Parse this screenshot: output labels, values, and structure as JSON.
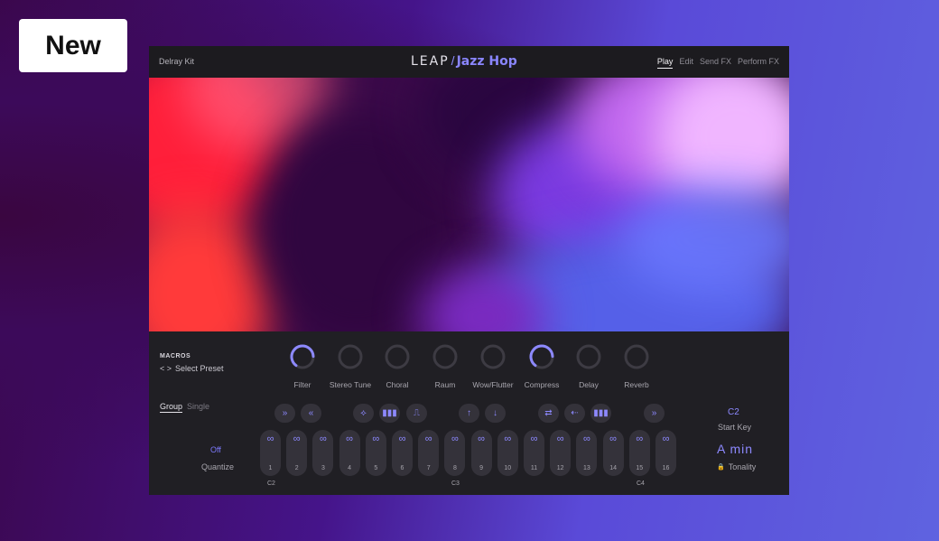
{
  "badge": "New",
  "header": {
    "kit_name": "Delray Kit",
    "brand_leap": "LEAP",
    "brand_slash": "/",
    "brand_name": "Jazz Hop",
    "tabs": [
      "Play",
      "Edit",
      "Send FX",
      "Perform FX"
    ],
    "active_tab": "Play"
  },
  "macros": {
    "title": "MACROS",
    "preset_arrows": "< >",
    "preset_label": "Select Preset",
    "knobs": [
      {
        "label": "Filter",
        "active": true,
        "level": 0.8
      },
      {
        "label": "Stereo Tune",
        "active": false,
        "level": 0
      },
      {
        "label": "Choral",
        "active": false,
        "level": 0
      },
      {
        "label": "Raum",
        "active": false,
        "level": 0
      },
      {
        "label": "Wow/Flutter",
        "active": false,
        "level": 0
      },
      {
        "label": "Compress",
        "active": true,
        "level": 0.8
      },
      {
        "label": "Delay",
        "active": false,
        "level": 0
      },
      {
        "label": "Reverb",
        "active": false,
        "level": 0
      }
    ]
  },
  "group_tabs": [
    "Group",
    "Single"
  ],
  "active_group_tab": "Group",
  "quantize": {
    "value": "Off",
    "label": "Quantize"
  },
  "actions": [
    {
      "icon": "fast-forward-icon",
      "glyph": "»"
    },
    {
      "icon": "rewind-icon",
      "glyph": "«"
    },
    {
      "icon": "shuffle-icon",
      "glyph": "⟡"
    },
    {
      "icon": "bars-icon",
      "glyph": "▮▮▮"
    },
    {
      "icon": "envelope-icon",
      "glyph": "⎍"
    },
    {
      "icon": "up-arrow-icon",
      "glyph": "↑"
    },
    {
      "icon": "down-arrow-icon",
      "glyph": "↓"
    },
    {
      "icon": "swap-icon",
      "glyph": "⇄"
    },
    {
      "icon": "scatter-icon",
      "glyph": "⇠"
    },
    {
      "icon": "bars-icon",
      "glyph": "▮▮▮"
    },
    {
      "icon": "fast-forward-icon",
      "glyph": "»"
    }
  ],
  "pads": {
    "glyph": "∞",
    "numbers": [
      "1",
      "2",
      "3",
      "4",
      "5",
      "6",
      "7",
      "8",
      "9",
      "10",
      "11",
      "12",
      "13",
      "14",
      "15",
      "16"
    ]
  },
  "note_labels": [
    "C2",
    "C3",
    "C4"
  ],
  "start_key": {
    "value": "C2",
    "label": "Start Key"
  },
  "tonality": {
    "value": "A  min",
    "label": "Tonality"
  },
  "colors": {
    "accent": "#8d89ff",
    "panel": "#201f24",
    "header": "#1c1b1f"
  }
}
